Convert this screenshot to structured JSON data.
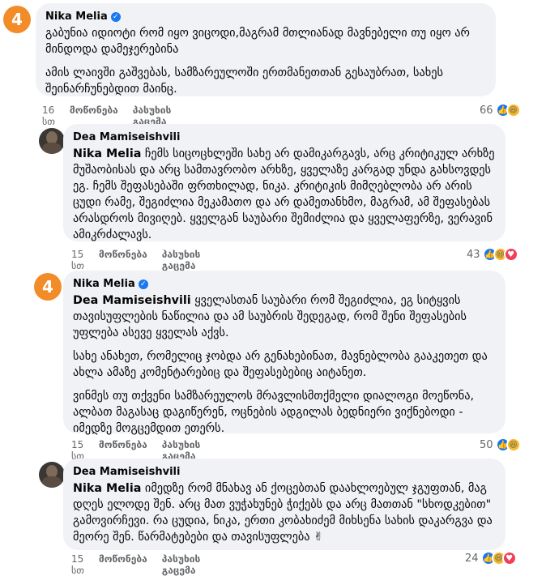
{
  "comments": [
    {
      "author": "Nika Melia",
      "avatar_text": "4",
      "paragraphs": [
        "გაბუნია იდიოტი რომ იყო ვიცოდი,მაგრამ მთლიანად მავნებელი თუ იყო არ მინდოდა დამეჯერებინა",
        "ამის ლაივში გაშვებას, სამზარეულოში ერთმანეთთან გესაუბრათ, სახეს შეინარჩუნებდით მაინც."
      ],
      "time": "16 სთ",
      "like_label": "მოწონება",
      "reply_label": "პასუხის გაცემა",
      "reaction_count": "66"
    },
    {
      "author": "Dea Mamiseishvili",
      "mention": "Nika Melia",
      "paragraphs": [
        "ჩემს სიცოცხლეში სახე არ დამიკარგავს, არც კრიტიკულ არხზე მუშაობისას და არც სამთავრობო არხზე, ყველაზე კარგად უნდა გახსოვდეს ეგ. ჩემს შეფასებაში ფრთხილად, ნიკა. კრიტიკის მიმღებლობა არ არის ცუდი რამე, შეგიძლია მეკამათო და არ დამეთანხმო, მაგრამ, ამ შეფასებას არასდროს მივიღებ. ყველგან საუბარი შემიძლია და ყველაფერზე, ვერავინ ამიკრძალავს."
      ],
      "time": "15 სთ",
      "like_label": "მოწონება",
      "reply_label": "პასუხის გაცემა",
      "reaction_count": "43"
    },
    {
      "author": "Nika Melia",
      "avatar_text": "4",
      "mention": "Dea Mamiseishvili",
      "paragraphs": [
        "ყველასთან საუბარი რომ შეგიძლია, ეგ სიტყვის თავისუფლების ნაწილია და ამ საუბრის შედეგად, რომ შენი შეფასების უფლება ასევე ყველას აქვს.",
        "სახე ანახეთ, რომელიც ჯობდა არ გენახებინათ, მავნებლობა გააკეთეთ და ახლა ამაზე კომენტარებიც და შეფასებებიც აიტანეთ.",
        "ვინმეს თუ თქვენი სამზარეულოს მრავლისმთქმელი დიალოგი მოეწონა, ალბათ მაგასაც დაგიწერენ, ოცნების ადგილას ბედნიერი ვიქნებოდი - იმედზე მოგცემდით ეთერს."
      ],
      "time": "15 სთ",
      "like_label": "მოწონება",
      "reply_label": "პასუხის გაცემა",
      "reaction_count": "50"
    },
    {
      "author": "Dea Mamiseishvili",
      "mention": "Nika Melia",
      "paragraphs": [
        "იმედზე რომ მნახავ ან ქოცებთან დაახლოებულ ჯგუფთან, მაგ დღეს ელოდე შენ. არც მათ ვუჭახუნებ ჭიქებს და არც მათთან \"სხოდკებით\" გამოვირჩევი. რა ცუდია, ნიკა, ერთი კობახიძემ მიხსენა სახის დაკარგვა და მეორე შენ. წარმატებები და თავისუფლება ✌"
      ],
      "time": "15 სთ",
      "like_label": "მოწონება",
      "reply_label": "პასუხის გაცემა",
      "reaction_count": "24"
    }
  ]
}
